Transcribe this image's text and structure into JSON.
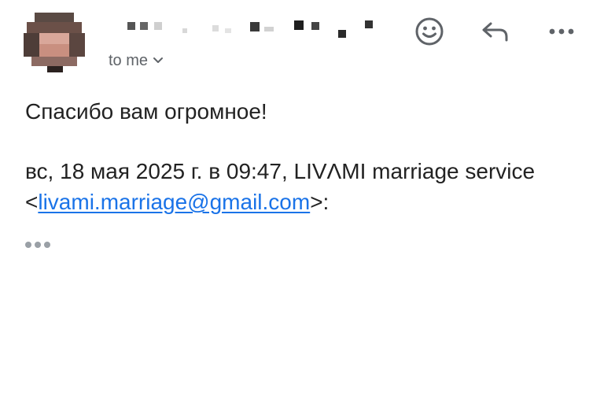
{
  "header": {
    "recipient_label": "to me"
  },
  "icons": {
    "emoji_reaction": "smiley-face-icon",
    "reply": "reply-arrow-icon",
    "more": "more-horizontal-icon",
    "recipient_dropdown": "chevron-down-icon"
  },
  "message": {
    "greeting": "Спасибо вам огромное!",
    "quote_intro": "вс, 18 мая 2025 г. в 09:47, LIVΛMI marriage service <",
    "quote_email": "livami.marriage@gmail.com",
    "quote_suffix": ">:"
  },
  "colors": {
    "link": "#1a73e8",
    "icon": "#5f6368",
    "text": "#222222"
  }
}
